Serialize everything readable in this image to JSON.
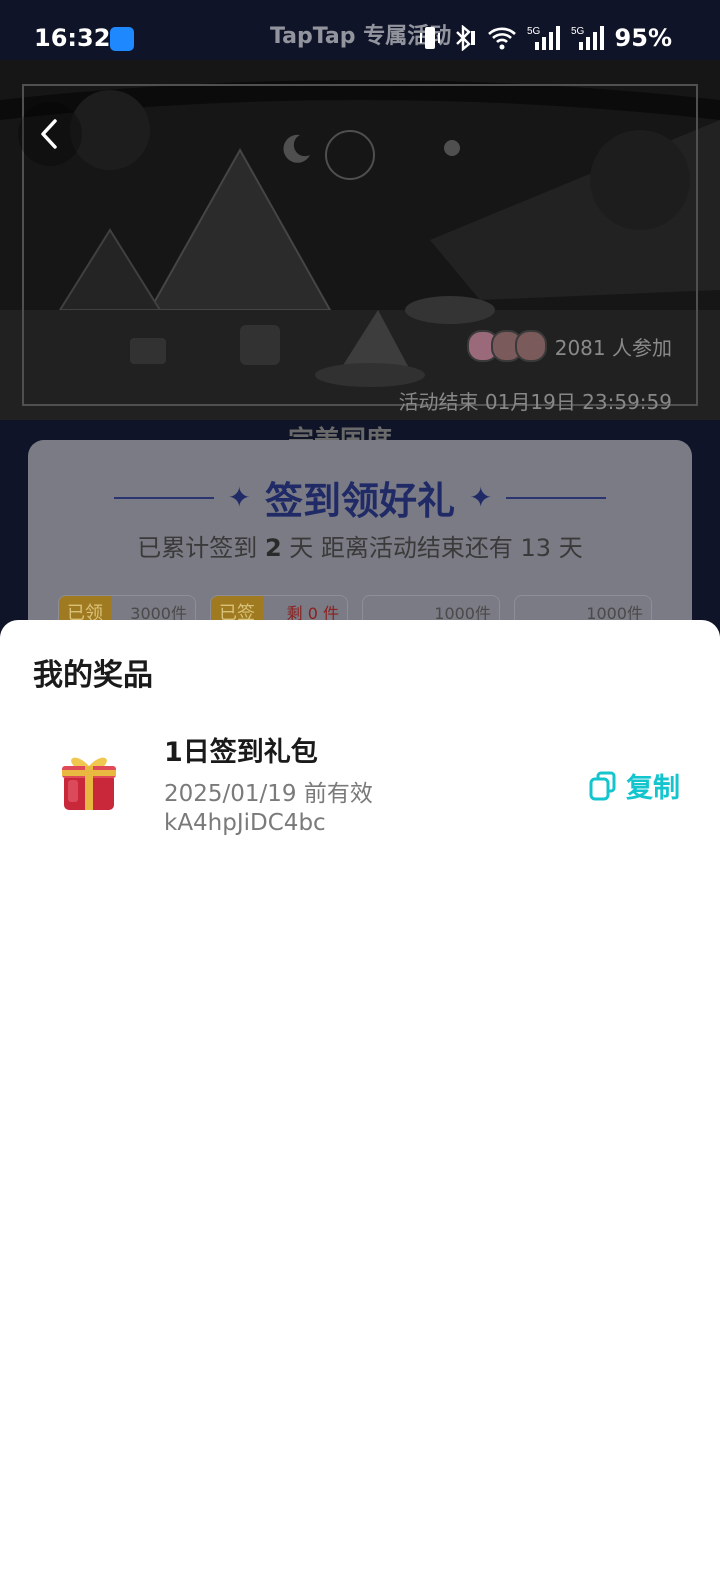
{
  "status_bar": {
    "time": "16:32",
    "watermark": "TapTap 专属活动",
    "battery": "95%",
    "signal_labels": [
      "5G",
      "5G"
    ]
  },
  "banner": {
    "participants": "2081 人参加",
    "end_time": "活动结束 01月19日 23:59:59",
    "partial_title": "完美国度"
  },
  "card": {
    "title": "签到领好礼",
    "sub_prefix": "已累计签到 ",
    "days_signed": "2",
    "sub_suffix": " 天  距离活动结束还有 13 天",
    "chips": [
      {
        "tag": "已领",
        "qty": "3000件"
      },
      {
        "tag": "已签",
        "qty": "剩 0 件"
      },
      {
        "tag": "",
        "qty": "1000件"
      },
      {
        "tag": "",
        "qty": "1000件"
      }
    ]
  },
  "sheet": {
    "title": "我的奖品",
    "prize": {
      "name": "1日签到礼包",
      "valid": "2025/01/19 前有效",
      "code": "kA4hpJiDC4bc",
      "copy_label": "复制"
    }
  },
  "colors": {
    "accent": "#15c5ce",
    "navy": "#1d2445",
    "title_navy": "#1f2a66"
  }
}
